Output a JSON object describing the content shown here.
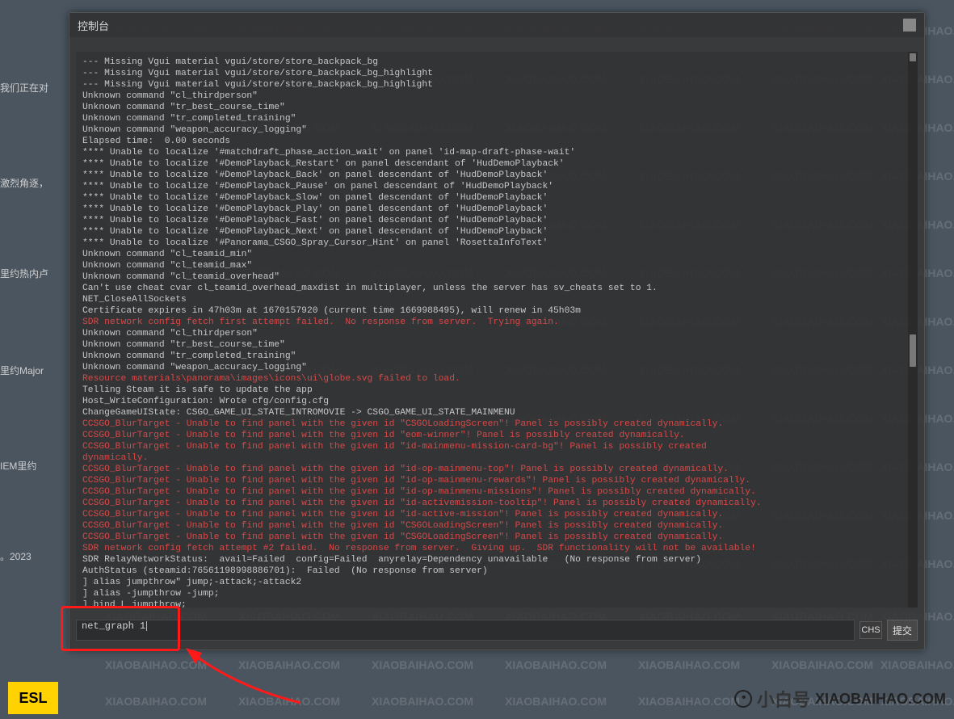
{
  "window": {
    "title": "控制台",
    "submit_label": "提交",
    "ime_label": "CHS"
  },
  "input": {
    "value": "net_graph 1"
  },
  "bg_left": {
    "t1": "我们正在对",
    "t2": "激烈角逐，",
    "t3": "里约热内卢",
    "t4": "里约Major",
    "t5": "IEM里约",
    "t6": "。2023"
  },
  "watermark": "XIAOBAIHAO.COM",
  "brand_cn": "小白号",
  "brand_url": "XIAOBAIHAO.COM",
  "esl": "ESL",
  "console_lines": [
    {
      "c": "normal",
      "t": "--- Missing Vgui material vgui/store/store_backpack_bg"
    },
    {
      "c": "normal",
      "t": "--- Missing Vgui material vgui/store/store_backpack_bg_highlight"
    },
    {
      "c": "normal",
      "t": "--- Missing Vgui material vgui/store/store_backpack_bg_highlight"
    },
    {
      "c": "normal",
      "t": "Unknown command \"cl_thirdperson\""
    },
    {
      "c": "normal",
      "t": "Unknown command \"tr_best_course_time\""
    },
    {
      "c": "normal",
      "t": "Unknown command \"tr_completed_training\""
    },
    {
      "c": "normal",
      "t": "Unknown command \"weapon_accuracy_logging\""
    },
    {
      "c": "normal",
      "t": "Elapsed time:  0.00 seconds"
    },
    {
      "c": "normal",
      "t": "**** Unable to localize '#matchdraft_phase_action_wait' on panel 'id-map-draft-phase-wait'"
    },
    {
      "c": "normal",
      "t": "**** Unable to localize '#DemoPlayback_Restart' on panel descendant of 'HudDemoPlayback'"
    },
    {
      "c": "normal",
      "t": "**** Unable to localize '#DemoPlayback_Back' on panel descendant of 'HudDemoPlayback'"
    },
    {
      "c": "normal",
      "t": "**** Unable to localize '#DemoPlayback_Pause' on panel descendant of 'HudDemoPlayback'"
    },
    {
      "c": "normal",
      "t": "**** Unable to localize '#DemoPlayback_Slow' on panel descendant of 'HudDemoPlayback'"
    },
    {
      "c": "normal",
      "t": "**** Unable to localize '#DemoPlayback_Play' on panel descendant of 'HudDemoPlayback'"
    },
    {
      "c": "normal",
      "t": "**** Unable to localize '#DemoPlayback_Fast' on panel descendant of 'HudDemoPlayback'"
    },
    {
      "c": "normal",
      "t": "**** Unable to localize '#DemoPlayback_Next' on panel descendant of 'HudDemoPlayback'"
    },
    {
      "c": "normal",
      "t": "**** Unable to localize '#Panorama_CSGO_Spray_Cursor_Hint' on panel 'RosettaInfoText'"
    },
    {
      "c": "normal",
      "t": "Unknown command \"cl_teamid_min\""
    },
    {
      "c": "normal",
      "t": "Unknown command \"cl_teamid_max\""
    },
    {
      "c": "normal",
      "t": "Unknown command \"cl_teamid_overhead\""
    },
    {
      "c": "normal",
      "t": "Can't use cheat cvar cl_teamid_overhead_maxdist in multiplayer, unless the server has sv_cheats set to 1."
    },
    {
      "c": "normal",
      "t": "NET_CloseAllSockets"
    },
    {
      "c": "normal",
      "t": "Certificate expires in 47h03m at 1670157920 (current time 1669988495), will renew in 45h03m"
    },
    {
      "c": "error",
      "t": "SDR network config fetch first attempt failed.  No response from server.  Trying again."
    },
    {
      "c": "normal",
      "t": "Unknown command \"cl_thirdperson\""
    },
    {
      "c": "normal",
      "t": "Unknown command \"tr_best_course_time\""
    },
    {
      "c": "normal",
      "t": "Unknown command \"tr_completed_training\""
    },
    {
      "c": "normal",
      "t": "Unknown command \"weapon_accuracy_logging\""
    },
    {
      "c": "error",
      "t": "Resource materials\\panorama\\images\\icons\\ui\\globe.svg failed to load."
    },
    {
      "c": "normal",
      "t": "Telling Steam it is safe to update the app"
    },
    {
      "c": "normal",
      "t": "Host_WriteConfiguration: Wrote cfg/config.cfg"
    },
    {
      "c": "normal",
      "t": "ChangeGameUIState: CSGO_GAME_UI_STATE_INTROMOVIE -> CSGO_GAME_UI_STATE_MAINMENU"
    },
    {
      "c": "error",
      "t": "CCSGO_BlurTarget - Unable to find panel with the given id \"CSGOLoadingScreen\"! Panel is possibly created dynamically."
    },
    {
      "c": "error",
      "t": "CCSGO_BlurTarget - Unable to find panel with the given id \"eom-winner\"! Panel is possibly created dynamically."
    },
    {
      "c": "error",
      "t": "CCSGO_BlurTarget - Unable to find panel with the given id \"id-mainmenu-mission-card-bg\"! Panel is possibly created"
    },
    {
      "c": "error",
      "t": "dynamically."
    },
    {
      "c": "error",
      "t": "CCSGO_BlurTarget - Unable to find panel with the given id \"id-op-mainmenu-top\"! Panel is possibly created dynamically."
    },
    {
      "c": "error",
      "t": "CCSGO_BlurTarget - Unable to find panel with the given id \"id-op-mainmenu-rewards\"! Panel is possibly created dynamically."
    },
    {
      "c": "error",
      "t": "CCSGO_BlurTarget - Unable to find panel with the given id \"id-op-mainmenu-missions\"! Panel is possibly created dynamically."
    },
    {
      "c": "error",
      "t": "CCSGO_BlurTarget - Unable to find panel with the given id \"id-activemission-tooltip\"! Panel is possibly created dynamically."
    },
    {
      "c": "error",
      "t": "CCSGO_BlurTarget - Unable to find panel with the given id \"id-active-mission\"! Panel is possibly created dynamically."
    },
    {
      "c": "error",
      "t": "CCSGO_BlurTarget - Unable to find panel with the given id \"CSGOLoadingScreen\"! Panel is possibly created dynamically."
    },
    {
      "c": "error",
      "t": "CCSGO_BlurTarget - Unable to find panel with the given id \"CSGOLoadingScreen\"! Panel is possibly created dynamically."
    },
    {
      "c": "error",
      "t": "SDR network config fetch attempt #2 failed.  No response from server.  Giving up.  SDR functionality will not be available!"
    },
    {
      "c": "normal",
      "t": "SDR RelayNetworkStatus:  avail=Failed  config=Failed  anyrelay=Dependency unavailable   (No response from server)"
    },
    {
      "c": "normal",
      "t": "AuthStatus (steamid:76561198998886701):  Failed  (No response from server)"
    },
    {
      "c": "normal",
      "t": "] alias jumpthrow\" jump;-attack;-attack2"
    },
    {
      "c": "normal",
      "t": "] alias -jumpthrow -jump;"
    },
    {
      "c": "normal",
      "t": "] bind L jumpthrow;"
    }
  ]
}
